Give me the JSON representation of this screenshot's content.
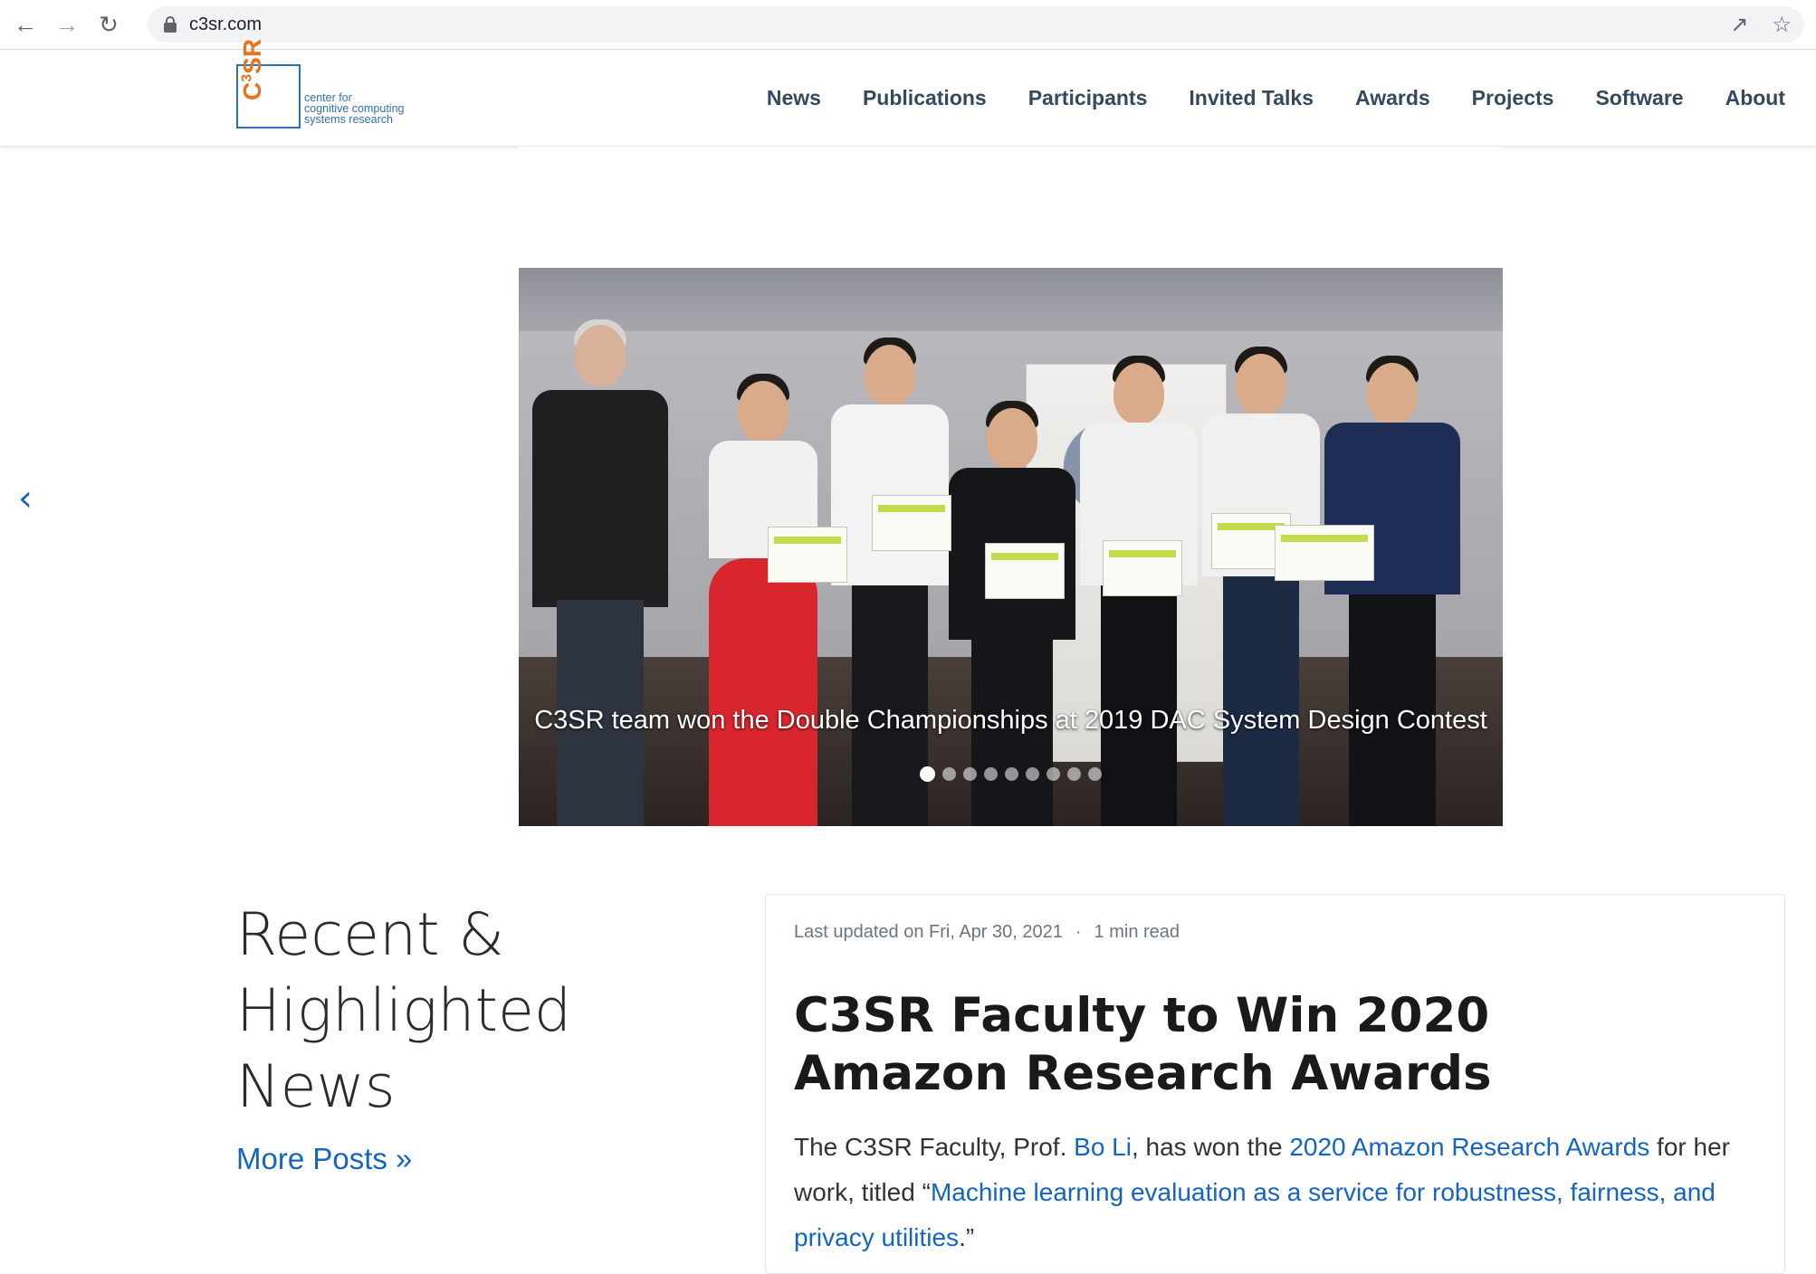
{
  "browser": {
    "url": "c3sr.com",
    "back_icon": "arrow-left-icon",
    "forward_icon": "arrow-right-icon",
    "reload_icon": "reload-icon",
    "share_icon": "share-icon",
    "bookmark_icon": "star-icon"
  },
  "header": {
    "logo_mark": "C",
    "logo_sup": "3",
    "logo_mark_tail": "SR",
    "logo_line1": "center for",
    "logo_line2": "cognitive computing",
    "logo_line3": "systems research",
    "nav": [
      "News",
      "Publications",
      "Participants",
      "Invited Talks",
      "Awards",
      "Projects",
      "Software",
      "About"
    ]
  },
  "carousel": {
    "caption": "C3SR team won the Double Championships at 2019 DAC System Design Contest",
    "slide_count": 9,
    "active_index": 0,
    "prev_label": "‹"
  },
  "news": {
    "heading": "Recent & Highlighted News",
    "more_posts": "More Posts »"
  },
  "post": {
    "last_updated": "Last updated on Fri, Apr 30, 2021",
    "separator": "·",
    "read_time": "1 min read",
    "title": "C3SR Faculty to Win 2020 Amazon Research Awards",
    "body_1": "The C3SR Faculty, Prof. ",
    "link_person": "Bo Li",
    "body_2": ", has won the ",
    "link_award": "2020 Amazon Research Awards",
    "body_3": " for her work, titled “",
    "link_work": "Machine learning evaluation as a service for robustness, fairness, and privacy utilities",
    "body_4": ".”"
  },
  "colors": {
    "nav_text": "#34495e",
    "link": "#1565c0",
    "logo_orange": "#e8741e",
    "logo_blue": "#2f6fb5"
  }
}
